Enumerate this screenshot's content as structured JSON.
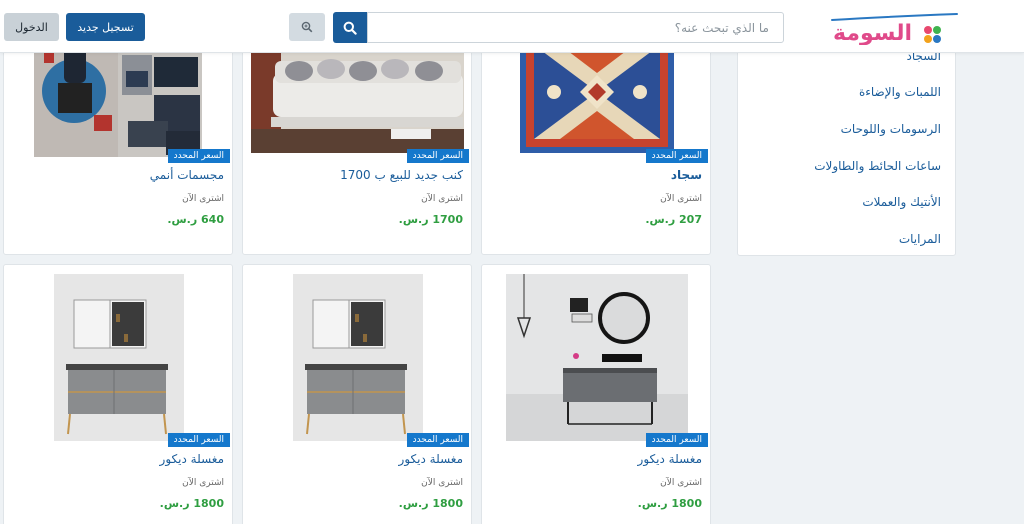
{
  "header": {
    "logo_text": "السومة",
    "search_placeholder": "ما الذي تبحث عنه؟",
    "register_label": "تسجيل جديد",
    "login_label": "الدخول",
    "search_icon": "search-icon",
    "zoom_icon": "zoom-icon",
    "brand_color": "#1a5c9a"
  },
  "categories": [
    {
      "label": "السجاد"
    },
    {
      "label": "اللمبات والإضاءة"
    },
    {
      "label": "الرسومات واللوحات"
    },
    {
      "label": "ساعات الحائط والطاولات"
    },
    {
      "label": "الأنتيك والعملات"
    },
    {
      "label": "المرايات"
    }
  ],
  "products": [
    {
      "badge": "السعر المحدد",
      "name": "سجاد",
      "buy": "اشترى الآن",
      "price": "207 ر.س."
    },
    {
      "badge": "السعر المحدد",
      "name": "كنب جديد للبيع ب 1700",
      "buy": "اشترى الآن",
      "price": "1700 ر.س."
    },
    {
      "badge": "السعر المحدد",
      "name": "مجسمات أنمي",
      "buy": "اشترى الآن",
      "price": "640 ر.س."
    },
    {
      "badge": "السعر المحدد",
      "name": "مغسلة ديكور",
      "buy": "اشترى الآن",
      "price": "1800 ر.س."
    },
    {
      "badge": "السعر المحدد",
      "name": "مغسلة ديكور",
      "buy": "اشترى الآن",
      "price": "1800 ر.س."
    },
    {
      "badge": "السعر المحدد",
      "name": "مغسلة ديكور",
      "buy": "اشترى الآن",
      "price": "1800 ر.س."
    }
  ]
}
